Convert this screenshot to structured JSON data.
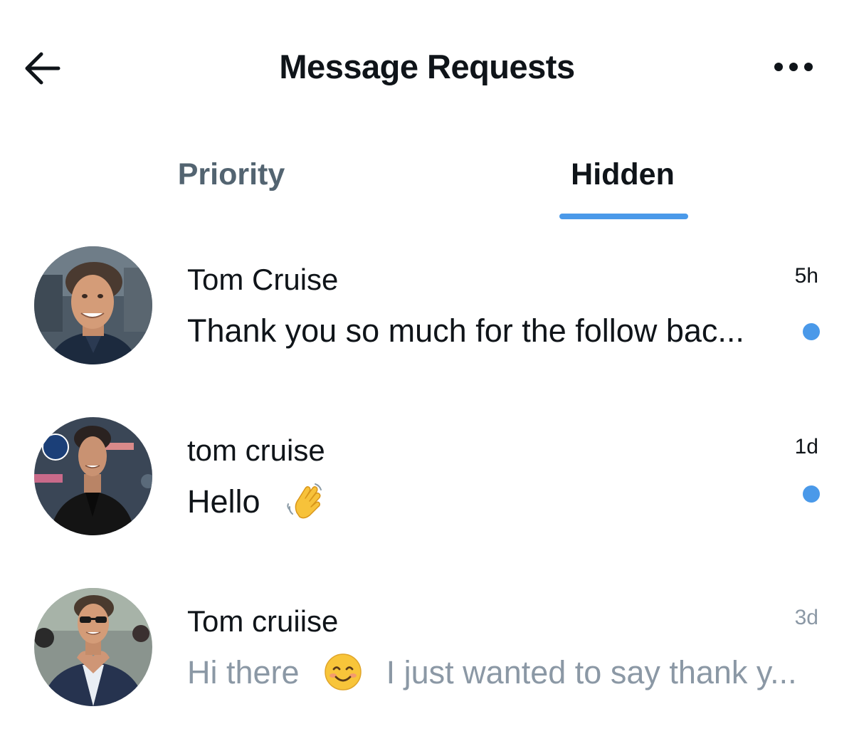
{
  "header": {
    "title": "Message Requests",
    "back_icon": "arrow-left-icon",
    "more_icon": "more-horizontal-icon"
  },
  "tabs": [
    {
      "label": "Priority",
      "active": false
    },
    {
      "label": "Hidden",
      "active": true
    }
  ],
  "colors": {
    "accent": "#4a99e9",
    "text_primary": "#0f1419",
    "text_secondary": "#536471",
    "text_muted": "#8b98a5"
  },
  "conversations": [
    {
      "name": "Tom Cruise",
      "time": "5h",
      "preview": "Thank you so much for the follow bac...",
      "unread": true
    },
    {
      "name": "tom cruise",
      "time": "1d",
      "preview_text": "Hello",
      "preview_emoji": "waving-hand-emoji",
      "unread": true
    },
    {
      "name": "Tom cruiise",
      "time": "3d",
      "preview_before": "Hi there",
      "preview_emoji": "smiling-face-emoji",
      "preview_after": "I just wanted to say thank y...",
      "unread": false
    }
  ]
}
